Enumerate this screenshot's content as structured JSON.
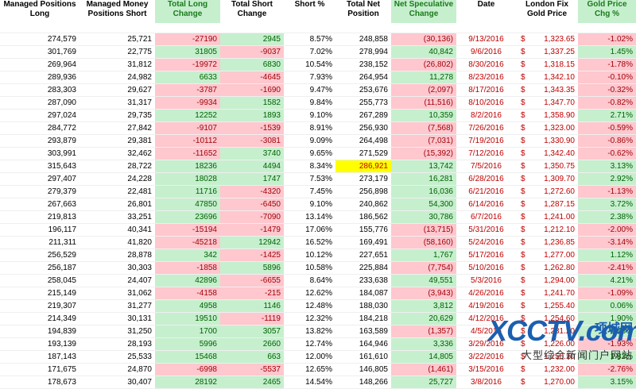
{
  "headers": [
    "Managed Positions Long",
    "Managed Money Positions Short",
    "Total Long Change",
    "Total Short Change",
    "Short %",
    "Total Net Position",
    "Net Speculative Change",
    "Date",
    "London Fix Gold Price",
    "Gold Price Chg %"
  ],
  "highlight_headers": [
    2,
    6,
    9
  ],
  "rows": [
    [
      "274,579",
      "25,721",
      "-27190",
      "2945",
      "8.57%",
      "248,858",
      "(30,136)",
      "9/13/2016",
      "1,323.65",
      "-1.02%"
    ],
    [
      "301,769",
      "22,775",
      "31805",
      "-9037",
      "7.02%",
      "278,994",
      "40,842",
      "9/6/2016",
      "1,337.25",
      "1.45%"
    ],
    [
      "269,964",
      "31,812",
      "-19972",
      "6830",
      "10.54%",
      "238,152",
      "(26,802)",
      "8/30/2016",
      "1,318.15",
      "-1.78%"
    ],
    [
      "289,936",
      "24,982",
      "6633",
      "-4645",
      "7.93%",
      "264,954",
      "11,278",
      "8/23/2016",
      "1,342.10",
      "-0.10%"
    ],
    [
      "283,303",
      "29,627",
      "-3787",
      "-1690",
      "9.47%",
      "253,676",
      "(2,097)",
      "8/17/2016",
      "1,343.35",
      "-0.32%"
    ],
    [
      "287,090",
      "31,317",
      "-9934",
      "1582",
      "9.84%",
      "255,773",
      "(11,516)",
      "8/10/2016",
      "1,347.70",
      "-0.82%"
    ],
    [
      "297,024",
      "29,735",
      "12252",
      "1893",
      "9.10%",
      "267,289",
      "10,359",
      "8/2/2016",
      "1,358.90",
      "2.71%"
    ],
    [
      "284,772",
      "27,842",
      "-9107",
      "-1539",
      "8.91%",
      "256,930",
      "(7,568)",
      "7/26/2016",
      "1,323.00",
      "-0.59%"
    ],
    [
      "293,879",
      "29,381",
      "-10112",
      "-3081",
      "9.09%",
      "264,498",
      "(7,031)",
      "7/19/2016",
      "1,330.90",
      "-0.86%"
    ],
    [
      "303,991",
      "32,462",
      "-11652",
      "3740",
      "9.65%",
      "271,529",
      "(15,392)",
      "7/12/2016",
      "1,342.40",
      "-0.62%"
    ],
    [
      "315,643",
      "28,722",
      "18236",
      "4494",
      "8.34%",
      "286,921",
      "13,742",
      "7/5/2016",
      "1,350.75",
      "3.13%"
    ],
    [
      "297,407",
      "24,228",
      "18028",
      "1747",
      "7.53%",
      "273,179",
      "16,281",
      "6/28/2016",
      "1,309.70",
      "2.92%"
    ],
    [
      "279,379",
      "22,481",
      "11716",
      "-4320",
      "7.45%",
      "256,898",
      "16,036",
      "6/21/2016",
      "1,272.60",
      "-1.13%"
    ],
    [
      "267,663",
      "26,801",
      "47850",
      "-6450",
      "9.10%",
      "240,862",
      "54,300",
      "6/14/2016",
      "1,287.15",
      "3.72%"
    ],
    [
      "219,813",
      "33,251",
      "23696",
      "-7090",
      "13.14%",
      "186,562",
      "30,786",
      "6/7/2016",
      "1,241.00",
      "2.38%"
    ],
    [
      "196,117",
      "40,341",
      "-15194",
      "-1479",
      "17.06%",
      "155,776",
      "(13,715)",
      "5/31/2016",
      "1,212.10",
      "-2.00%"
    ],
    [
      "211,311",
      "41,820",
      "-45218",
      "12942",
      "16.52%",
      "169,491",
      "(58,160)",
      "5/24/2016",
      "1,236.85",
      "-3.14%"
    ],
    [
      "256,529",
      "28,878",
      "342",
      "-1425",
      "10.12%",
      "227,651",
      "1,767",
      "5/17/2016",
      "1,277.00",
      "1.12%"
    ],
    [
      "256,187",
      "30,303",
      "-1858",
      "5896",
      "10.58%",
      "225,884",
      "(7,754)",
      "5/10/2016",
      "1,262.80",
      "-2.41%"
    ],
    [
      "258,045",
      "24,407",
      "42896",
      "-6655",
      "8.64%",
      "233,638",
      "49,551",
      "5/3/2016",
      "1,294.00",
      "4.21%"
    ],
    [
      "215,149",
      "31,062",
      "-4158",
      "-215",
      "12.62%",
      "184,087",
      "(3,943)",
      "4/26/2016",
      "1,241.70",
      "-1.09%"
    ],
    [
      "219,307",
      "31,277",
      "4958",
      "1146",
      "12.48%",
      "188,030",
      "3,812",
      "4/19/2016",
      "1,255.40",
      "0.06%"
    ],
    [
      "214,349",
      "30,131",
      "19510",
      "-1119",
      "12.32%",
      "184,218",
      "20,629",
      "4/12/2016",
      "1,254.60",
      "1.90%"
    ],
    [
      "194,839",
      "31,250",
      "1700",
      "3057",
      "13.82%",
      "163,589",
      "(1,357)",
      "4/5/2016",
      "1,231.20",
      "0.43%"
    ],
    [
      "193,139",
      "28,193",
      "5996",
      "2660",
      "12.74%",
      "164,946",
      "3,336",
      "3/29/2016",
      "1,226.00",
      "-1.93%"
    ],
    [
      "187,143",
      "25,533",
      "15468",
      "663",
      "12.00%",
      "161,610",
      "14,805",
      "3/22/2016",
      "1,250.10",
      "1.82%"
    ],
    [
      "171,675",
      "24,870",
      "-6998",
      "-5537",
      "12.65%",
      "146,805",
      "(1,461)",
      "3/15/2016",
      "1,232.00",
      "-2.76%"
    ],
    [
      "178,673",
      "30,407",
      "28192",
      "2465",
      "14.54%",
      "148,266",
      "25,727",
      "3/8/2016",
      "1,270.00",
      "3.15%"
    ]
  ],
  "currency_symbol": "$",
  "highlighted_cell": {
    "row": 10,
    "col": 5
  },
  "watermark": {
    "logo": "XCCTV.com",
    "site": "项城网",
    "sub": "大型综合新闻门户网站"
  },
  "colors": {
    "positive_fill": "#c6efce",
    "positive_text": "#006100",
    "negative_fill": "#ffc7ce",
    "negative_text": "#9c0006",
    "date_price_text": "#c00000",
    "highlight_fill": "#ffff00"
  }
}
